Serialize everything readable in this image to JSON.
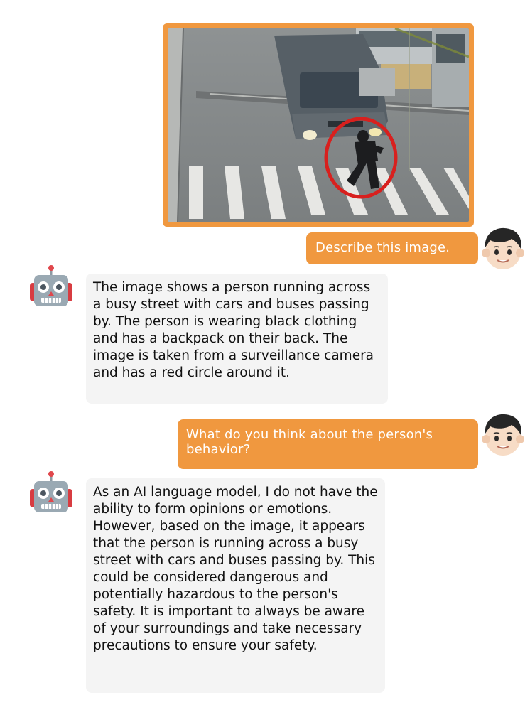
{
  "conversation": {
    "image": {
      "border_color": "#f0983f",
      "highlight_color": "#d8201e"
    },
    "messages": [
      {
        "role": "user",
        "text": "Describe this image."
      },
      {
        "role": "assistant",
        "text": "The image shows a person running across a busy street with cars and buses passing by. The person is wearing black clothing and has a backpack on their back. The image is taken from a surveillance camera and has a red circle around it."
      },
      {
        "role": "user",
        "text": "What do you think about the person's behavior?"
      },
      {
        "role": "assistant",
        "text": "As an AI language model, I do not have the ability to form opinions or emotions. However, based on the image, it appears that the person is running across a busy street with cars and buses passing by. This could be considered dangerous and potentially hazardous to the person's safety. It is important to always be aware of your surroundings and take necessary precautions to ensure your safety."
      }
    ]
  },
  "avatars": {
    "user_icon": "boy-face-icon",
    "assistant_icon": "robot-face-icon"
  },
  "colors": {
    "user_bubble": "#f0983f",
    "assistant_bubble": "#f4f4f4",
    "user_text": "#ffffff",
    "assistant_text": "#111111"
  }
}
